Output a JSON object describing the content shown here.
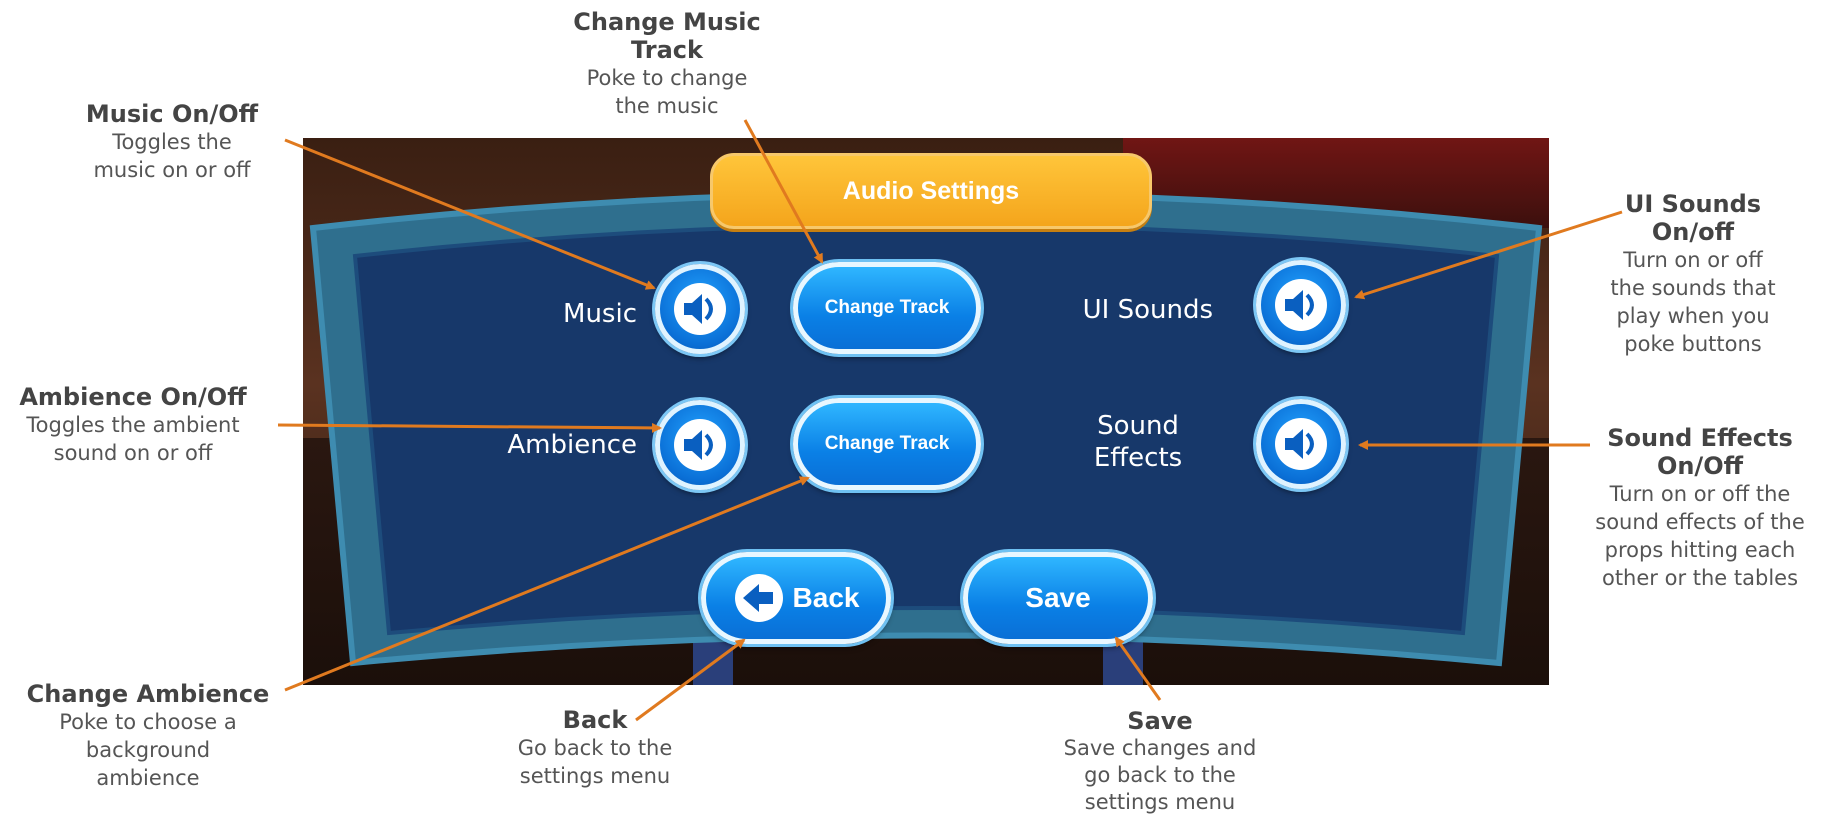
{
  "panel": {
    "title": "Audio Settings",
    "music_label": "Music",
    "ambience_label": "Ambience",
    "ui_sounds_label": "UI Sounds",
    "sound_effects_line1": "Sound",
    "sound_effects_line2": "Effects",
    "change_track_1": "Change Track",
    "change_track_2": "Change Track",
    "back_label": "Back",
    "save_label": "Save"
  },
  "annotations": {
    "change_music_track": {
      "title_line1": "Change Music",
      "title_line2": "Track",
      "desc_line1": "Poke to change",
      "desc_line2": "the music"
    },
    "music_onoff": {
      "title": "Music On/Off",
      "desc_line1": "Toggles the",
      "desc_line2": "music on or off"
    },
    "ambience_onoff": {
      "title": "Ambience On/Off",
      "desc_line1": "Toggles the ambient",
      "desc_line2": "sound on or off"
    },
    "change_ambience": {
      "title": "Change Ambience",
      "desc_line1": "Poke to choose a",
      "desc_line2": "background",
      "desc_line3": "ambience"
    },
    "back": {
      "title": "Back",
      "desc_line1": "Go back to the",
      "desc_line2": "settings menu"
    },
    "save": {
      "title": "Save",
      "desc_line1": "Save changes and",
      "desc_line2": "go back to the",
      "desc_line3": "settings menu"
    },
    "ui_sounds_onoff": {
      "title_line1": "UI Sounds",
      "title_line2": "On/off",
      "desc_line1": "Turn on or off",
      "desc_line2": "the sounds that",
      "desc_line3": "play when you",
      "desc_line4": "poke buttons"
    },
    "sound_effects_onoff": {
      "title_line1": "Sound Effects",
      "title_line2": "On/Off",
      "desc_line1": "Turn on or off the",
      "desc_line2": "sound effects of the",
      "desc_line3": "props hitting each",
      "desc_line4": "other or the tables"
    }
  },
  "colors": {
    "arrow": "#e07a1f",
    "title_pill": "#f4a51c",
    "button_blue": "#0a80e6",
    "panel_blue": "#17386a"
  },
  "icons": {
    "speaker": "speaker-icon",
    "back": "back-arrow-icon"
  }
}
